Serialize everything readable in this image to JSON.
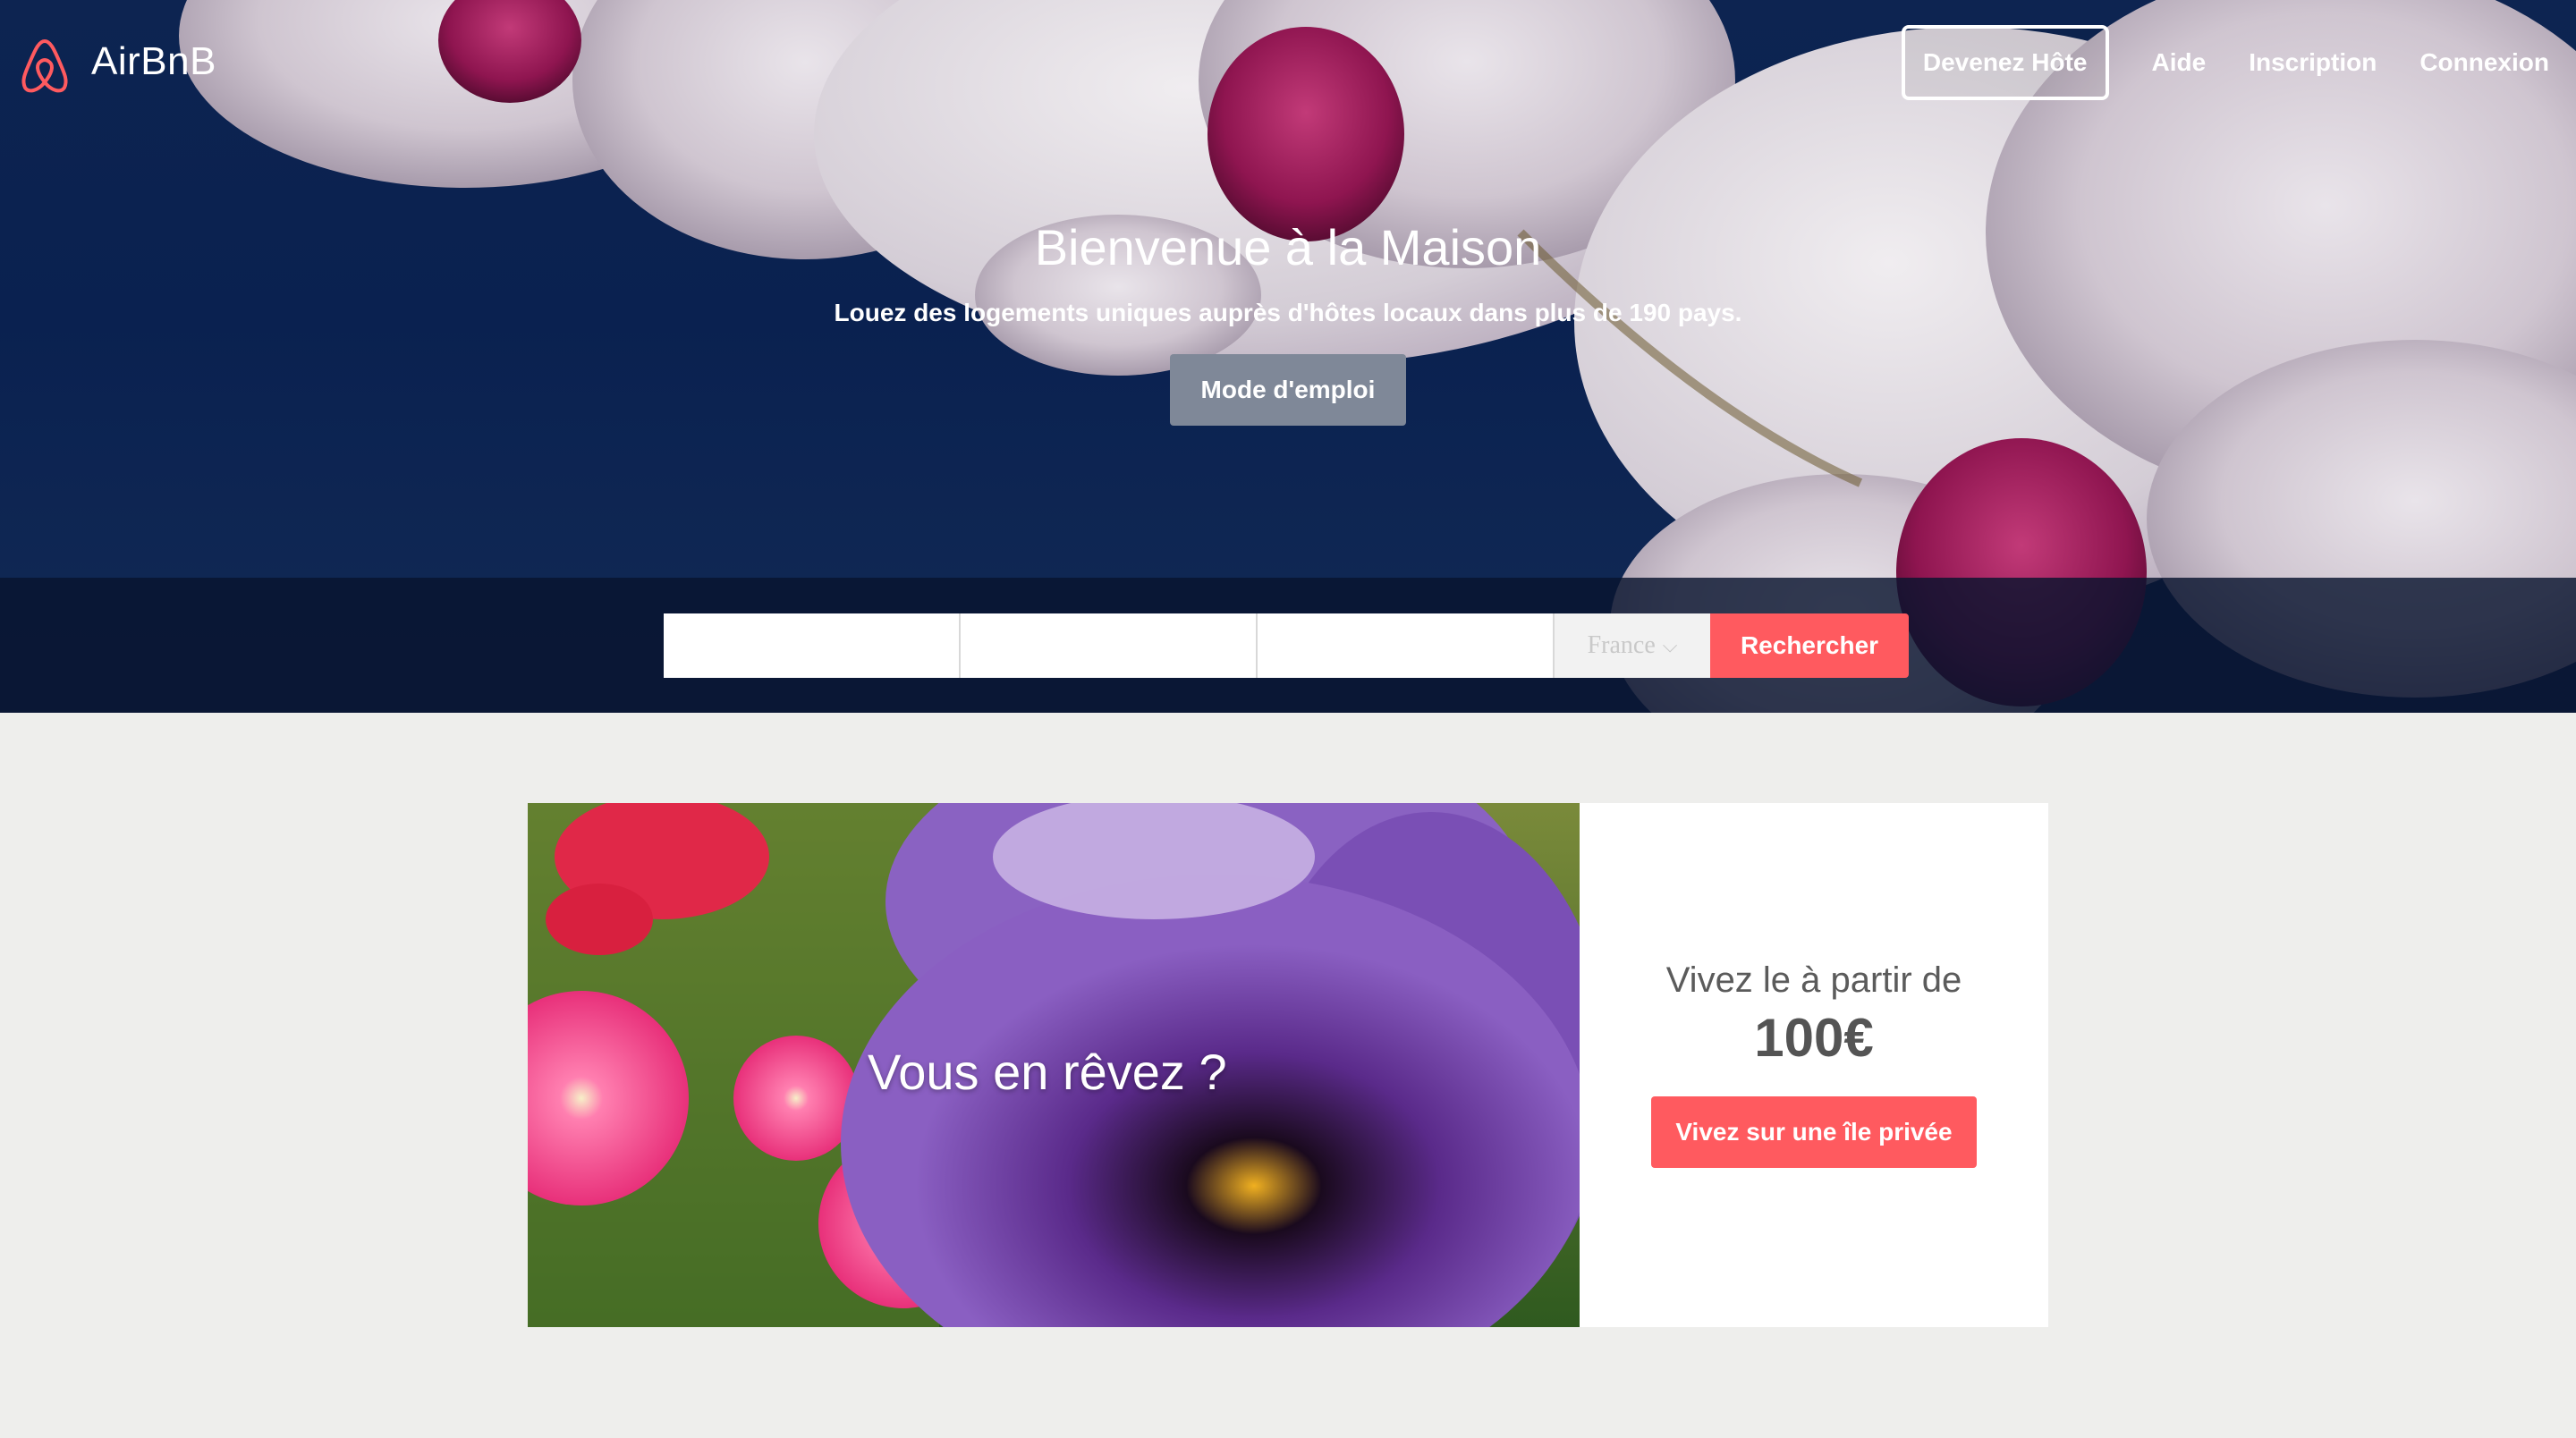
{
  "brand": {
    "name": "AirBnB",
    "logo_icon": "airbnb-belo-icon",
    "accent": "#ff5a5f"
  },
  "nav": {
    "host_label": "Devenez Hôte",
    "help_label": "Aide",
    "signup_label": "Inscription",
    "login_label": "Connexion"
  },
  "hero": {
    "title": "Bienvenue à la Maison",
    "subtitle": "Louez des logements uniques auprès d'hôtes locaux dans plus de 190 pays.",
    "button_label": "Mode d'emploi"
  },
  "search": {
    "field1_value": "",
    "field2_value": "",
    "field3_value": "",
    "country_selected": "France",
    "dropdown_icon": "chevron-down-icon",
    "button_label": "Rechercher"
  },
  "promo": {
    "image_caption": "Vous en rêvez ?",
    "lead": "Vivez le à partir de",
    "price": "100€",
    "cta_label": "Vivez sur une île privée"
  }
}
